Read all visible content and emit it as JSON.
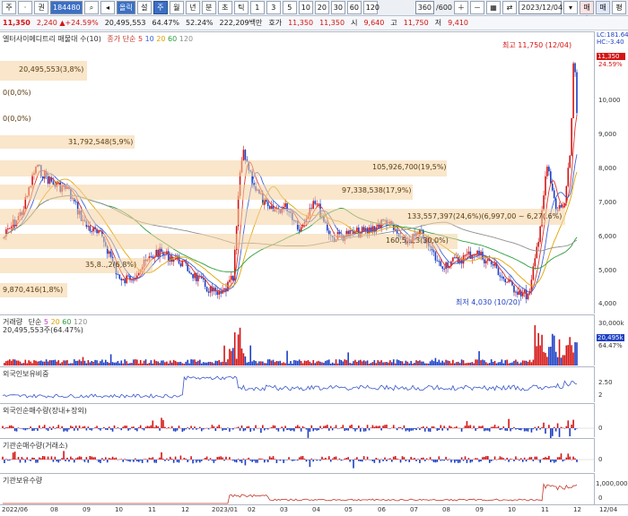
{
  "toolbar": {
    "b1": "주",
    "b2": "·",
    "b3": "권",
    "code": "184480",
    "name": "올릭스사이메",
    "b4": "설",
    "b5": "주",
    "b6": "월",
    "b7": "년",
    "b8": "분",
    "b9": "초",
    "b10": "틱",
    "periods": [
      "1",
      "3",
      "5",
      "10",
      "20",
      "30",
      "60",
      "120"
    ],
    "count": "360",
    "total": "/600",
    "date": "2023/12/04",
    "buy": "매수",
    "sell": "매도",
    "eval": "평"
  },
  "quote": {
    "price": "11,350",
    "change": "2,240 ▲+24.59%",
    "volume": "20,495,553",
    "pct1": "64.47%",
    "pct2": "52.24%",
    "amount": "222,209백만",
    "ask_label": "호가",
    "ask1": "11,350",
    "ask2": "11,350",
    "open_label": "시",
    "open": "9,640",
    "high_label": "고",
    "high": "11,750",
    "low_label": "저",
    "low": "9,410"
  },
  "main": {
    "title": "엘터사이메디트리 매물대",
    "count": "수(10)",
    "ma_label": "종가 단순",
    "ma": [
      "5",
      "10",
      "20",
      "60",
      "120"
    ],
    "high_label": "최고 11,750 (12/04)",
    "low_label": "최저 4,030 (10/20)",
    "lc": "LC:181.64",
    "hc": "HC:-3.40",
    "cur_price": "11,350",
    "cur_pct": "24.59%",
    "price_ticks": [
      "10,000",
      "9,000",
      "8,000",
      "7,000",
      "6,000",
      "5,000",
      "4,000"
    ],
    "bands": [
      "20,495,553(3,8%)",
      "0(0,0%)",
      "0(0,0%)",
      "31,792,548(5,9%)",
      "105,926,700(19,5%)",
      "97,338,538(17,9%)",
      "133,557,397(24,6%)(6,997,00 ~ 6,27(.6%)",
      "160,5...,3(30,0%)",
      "35,8..,2(6,8%)",
      "9,870,416(1,8%)"
    ]
  },
  "vol": {
    "title": "거래량",
    "ma_label": "단순",
    "ma": [
      "5",
      "20",
      "60",
      "120"
    ],
    "value": "20,495,553주(64.47%)",
    "tick": "30,000k",
    "cur": "20,495k",
    "pct": "64.47%"
  },
  "foreign_hold": {
    "title": "외국인보유비중",
    "tick": "2.50",
    "tick2": "2"
  },
  "foreign_net": {
    "title": "외국인순매수량(장내+장외)",
    "tick": "0"
  },
  "inst_net": {
    "title": "기관순매수량(거래소)",
    "tick": "0"
  },
  "inst_hold": {
    "title": "기관보유수량",
    "tick": "1,000,000",
    "tick2": "0"
  },
  "xaxis": [
    "2022/06",
    "08",
    "09",
    "10",
    "11",
    "12",
    "2023/01",
    "02",
    "03",
    "04",
    "05",
    "06",
    "07",
    "08",
    "09",
    "10",
    "11",
    "12"
  ],
  "xend": "12/04",
  "colors": {
    "up": "#d41414",
    "down": "#1c3fc4",
    "band": "#f4d2a0"
  }
}
